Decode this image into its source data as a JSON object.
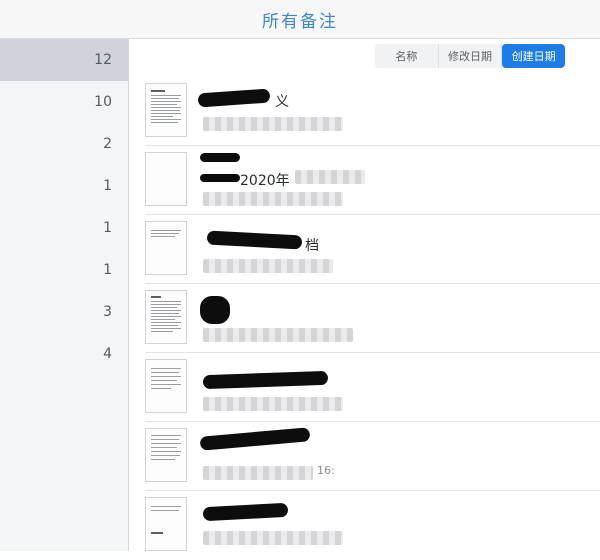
{
  "header": {
    "title": "所有备注"
  },
  "sidebar": {
    "counts": [
      "12",
      "10",
      "2",
      "1",
      "1",
      "1",
      "3",
      "4"
    ],
    "active_index": 0
  },
  "sort": {
    "options": [
      "名称",
      "修改日期",
      "创建日期"
    ],
    "active": "创建日期"
  },
  "notes": [
    {
      "title_visible": "义",
      "subtitle_visible": "",
      "thumbnail": "document"
    },
    {
      "title_visible": "2020年",
      "subtitle_visible": "",
      "thumbnail": "blank"
    },
    {
      "title_visible": "档",
      "subtitle_visible": "",
      "thumbnail": "document"
    },
    {
      "title_visible": "",
      "subtitle_visible": "",
      "thumbnail": "document"
    },
    {
      "title_visible": "",
      "subtitle_visible": "",
      "thumbnail": "document"
    },
    {
      "title_visible": "",
      "subtitle_visible": "16:",
      "thumbnail": "document"
    },
    {
      "title_visible": "",
      "subtitle_visible": "",
      "thumbnail": "document"
    }
  ],
  "colors": {
    "accent": "#1d7ce8",
    "title": "#3e86cf",
    "sidebar_active": "#d0d3d9"
  }
}
